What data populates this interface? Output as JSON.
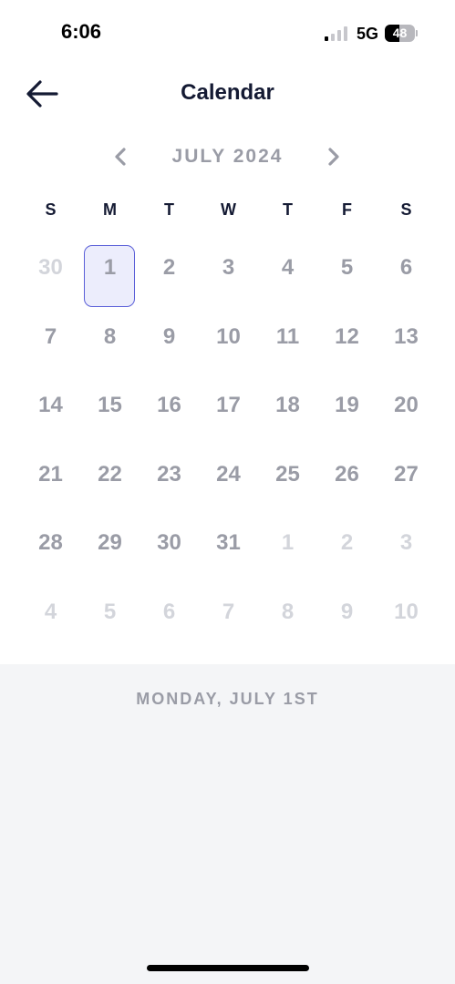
{
  "status_bar": {
    "time": "6:06",
    "network": "5G",
    "battery": "48",
    "battery_level": 0.48,
    "signal_bars_active": 1
  },
  "header": {
    "title": "Calendar",
    "back_icon": "arrow-left-icon"
  },
  "calendar": {
    "month_label": "JULY 2024",
    "prev_icon": "chevron-left-icon",
    "next_icon": "chevron-right-icon",
    "weekdays": [
      "S",
      "M",
      "T",
      "W",
      "T",
      "F",
      "S"
    ],
    "selected_day": "1",
    "days": [
      {
        "n": "30",
        "other": true
      },
      {
        "n": "1",
        "selected": true
      },
      {
        "n": "2"
      },
      {
        "n": "3"
      },
      {
        "n": "4"
      },
      {
        "n": "5"
      },
      {
        "n": "6"
      },
      {
        "n": "7"
      },
      {
        "n": "8"
      },
      {
        "n": "9"
      },
      {
        "n": "10"
      },
      {
        "n": "11"
      },
      {
        "n": "12"
      },
      {
        "n": "13"
      },
      {
        "n": "14"
      },
      {
        "n": "15"
      },
      {
        "n": "16"
      },
      {
        "n": "17"
      },
      {
        "n": "18"
      },
      {
        "n": "19"
      },
      {
        "n": "20"
      },
      {
        "n": "21"
      },
      {
        "n": "22"
      },
      {
        "n": "23"
      },
      {
        "n": "24"
      },
      {
        "n": "25"
      },
      {
        "n": "26"
      },
      {
        "n": "27"
      },
      {
        "n": "28"
      },
      {
        "n": "29"
      },
      {
        "n": "30"
      },
      {
        "n": "31"
      },
      {
        "n": "1",
        "other": true
      },
      {
        "n": "2",
        "other": true
      },
      {
        "n": "3",
        "other": true
      },
      {
        "n": "4",
        "other": true
      },
      {
        "n": "5",
        "other": true
      },
      {
        "n": "6",
        "other": true
      },
      {
        "n": "7",
        "other": true
      },
      {
        "n": "8",
        "other": true
      },
      {
        "n": "9",
        "other": true
      },
      {
        "n": "10",
        "other": true
      }
    ]
  },
  "detail": {
    "selected_date_label": "MONDAY, JULY 1ST"
  },
  "colors": {
    "title": "#141a33",
    "muted": "#9a9ca6",
    "outside_month": "#d3d5db",
    "selected_border": "#5a5fd8",
    "selected_fill": "#ecedfc",
    "panel_bg": "#f4f5f7"
  }
}
